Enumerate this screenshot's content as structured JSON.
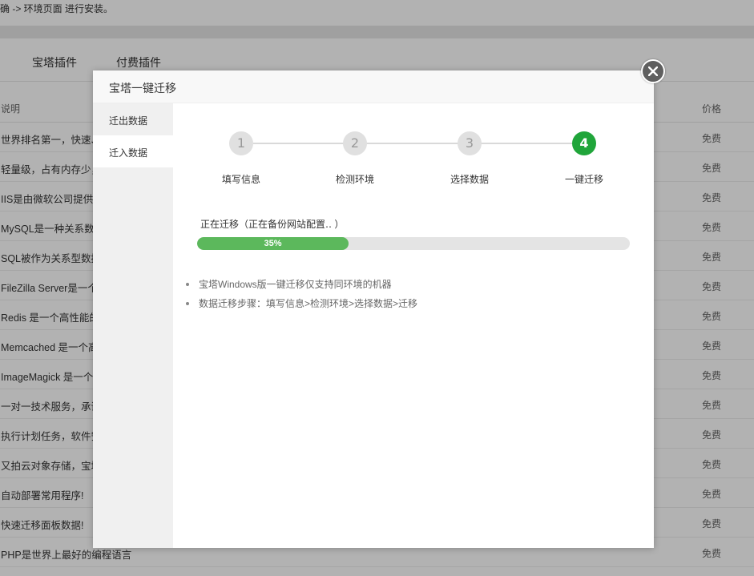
{
  "background": {
    "top_text": "确 -> 环境页面 进行安装。",
    "tabs": [
      "宝塔插件",
      "付费插件"
    ],
    "table_headers": {
      "description": "说明",
      "price": "价格"
    },
    "rows": [
      {
        "description": "世界排名第一，快速、",
        "price": "免费"
      },
      {
        "description": "轻量级，占有内存少，",
        "price": "免费"
      },
      {
        "description": "IIS是由微软公司提供的",
        "price": "免费"
      },
      {
        "description": "MySQL是一种关系数",
        "price": "免费"
      },
      {
        "description": "SQL被作为关系型数据",
        "price": "免费"
      },
      {
        "description": "FileZilla Server是一个",
        "price": "免费"
      },
      {
        "description": "Redis 是一个高性能的",
        "price": "免费"
      },
      {
        "description": "Memcached 是一个高",
        "price": "免费"
      },
      {
        "description": "ImageMagick 是一个",
        "price": "免费"
      },
      {
        "description": "一对一技术服务，承诺",
        "price": "免费"
      },
      {
        "description": "执行计划任务，软件安",
        "price": "免费"
      },
      {
        "description": "又拍云对象存储，宝塔",
        "price": "免费"
      },
      {
        "description": "自动部署常用程序!",
        "price": "免费"
      },
      {
        "description": "快速迁移面板数据!",
        "price": "免费"
      },
      {
        "description": "PHP是世界上最好的编程语言",
        "price": "免费"
      }
    ]
  },
  "dialog": {
    "title": "宝塔一键迁移",
    "close_icon": "close-icon",
    "sidebar": [
      {
        "label": "迁出数据",
        "active": false
      },
      {
        "label": "迁入数据",
        "active": true
      }
    ],
    "steps": [
      {
        "number": "1",
        "label": "填写信息",
        "done": false
      },
      {
        "number": "2",
        "label": "检测环境",
        "done": false
      },
      {
        "number": "3",
        "label": "选择数据",
        "done": false
      },
      {
        "number": "4",
        "label": "一键迁移",
        "done": true
      }
    ],
    "status_text": "正在迁移（正在备份网站配置‥ ）",
    "progress": {
      "percent": 35,
      "label": "35%"
    },
    "notes": [
      "宝塔Windows版一键迁移仅支持同环境的机器",
      "数据迁移步骤：填写信息>检测环境>选择数据>迁移"
    ],
    "colors": {
      "accent": "#20a53a",
      "progress_fill": "#5cb85c"
    }
  }
}
